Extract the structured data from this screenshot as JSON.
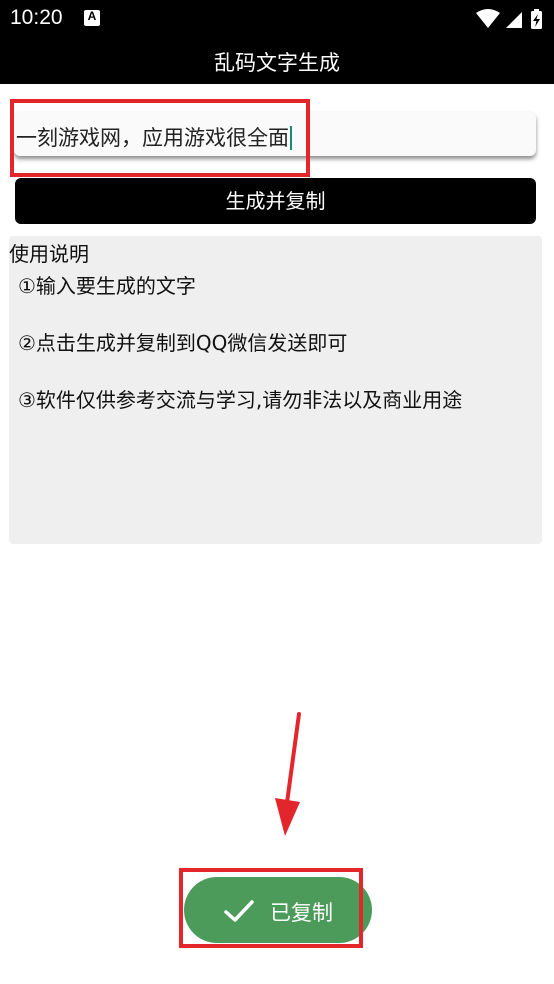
{
  "status_bar": {
    "time": "10:20",
    "notification_icon": "A"
  },
  "app_bar": {
    "title": "乱码文字生成"
  },
  "input": {
    "value": "一刻游戏网，应用游戏很全面"
  },
  "generate_button": {
    "label": "生成并复制"
  },
  "instructions": {
    "title": "使用说明",
    "lines": [
      "①输入要生成的文字",
      "②点击生成并复制到QQ微信发送即可",
      "③软件仅供参考交流与学习,请勿非法以及商业用途"
    ]
  },
  "toast": {
    "label": "已复制",
    "icon": "checkmark-icon"
  },
  "colors": {
    "toast_bg": "#4c9b5a",
    "highlight": "#e3262b",
    "cursor": "#1a8a76"
  }
}
